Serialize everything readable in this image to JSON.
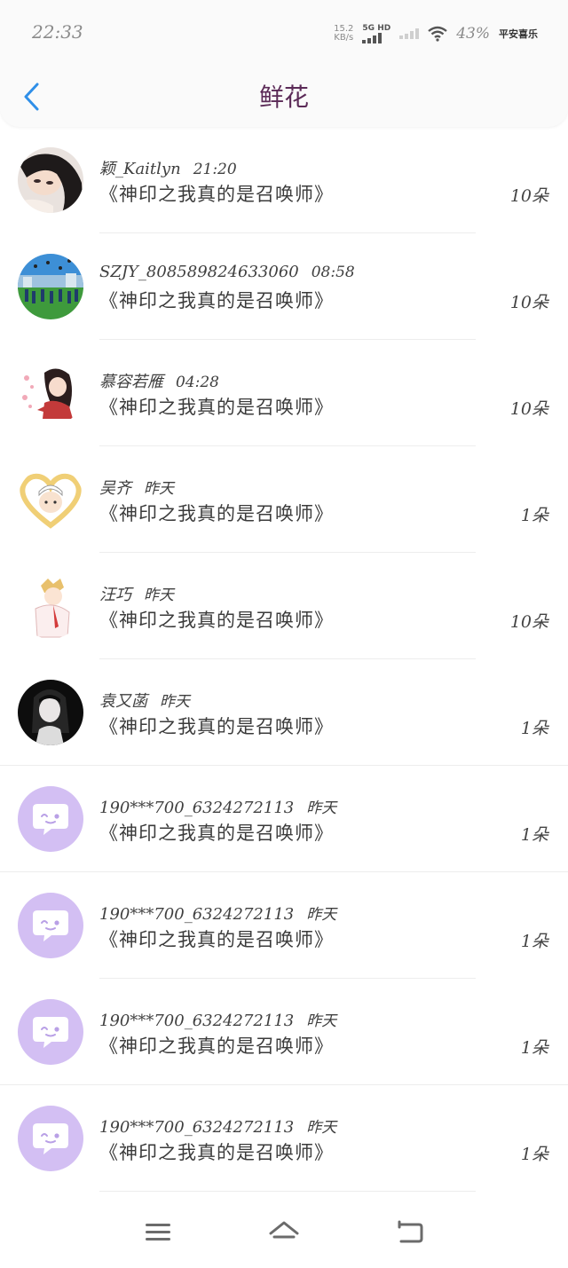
{
  "status_bar": {
    "time": "22:33",
    "net_speed": "15.2",
    "net_speed_unit": "KB/s",
    "network_label": "5G HD",
    "battery": "43%",
    "brand_text": "平安喜乐"
  },
  "header": {
    "title": "鲜花"
  },
  "rows": [
    {
      "name": "颖_Kaitlyn",
      "time": "21:20",
      "book": "《神印之我真的是召唤师》",
      "count": "10朵",
      "avatar": "photo-girl"
    },
    {
      "name": "SZJY_808589824633060",
      "time": "08:58",
      "book": "《神印之我真的是召唤师》",
      "count": "10朵",
      "avatar": "photo-field"
    },
    {
      "name": "慕容若雁",
      "time": "04:28",
      "book": "《神印之我真的是召唤师》",
      "count": "10朵",
      "avatar": "anime-girl"
    },
    {
      "name": "吴齐",
      "time": "昨天",
      "book": "《神印之我真的是召唤师》",
      "count": "1朵",
      "avatar": "anime-heart"
    },
    {
      "name": "汪巧",
      "time": "昨天",
      "book": "《神印之我真的是召唤师》",
      "count": "10朵",
      "avatar": "anime-boy"
    },
    {
      "name": "袁又菡",
      "time": "昨天",
      "book": "《神印之我真的是召唤师》",
      "count": "1朵",
      "avatar": "anime-dark"
    },
    {
      "name": "190***700_6324272113",
      "time": "昨天",
      "book": "《神印之我真的是召唤师》",
      "count": "1朵",
      "avatar": "default-chat"
    },
    {
      "name": "190***700_6324272113",
      "time": "昨天",
      "book": "《神印之我真的是召唤师》",
      "count": "1朵",
      "avatar": "default-chat"
    },
    {
      "name": "190***700_6324272113",
      "time": "昨天",
      "book": "《神印之我真的是召唤师》",
      "count": "1朵",
      "avatar": "default-chat"
    },
    {
      "name": "190***700_6324272113",
      "time": "昨天",
      "book": "《神印之我真的是召唤师》",
      "count": "1朵",
      "avatar": "default-chat"
    }
  ],
  "nav": {
    "menu_icon": "menu-icon",
    "home_icon": "home-icon",
    "back_icon": "return-icon"
  },
  "colors": {
    "accent_blue": "#2f8fe8",
    "title_purple": "#5b2a57",
    "avatar_purple": "#d3bff3"
  }
}
